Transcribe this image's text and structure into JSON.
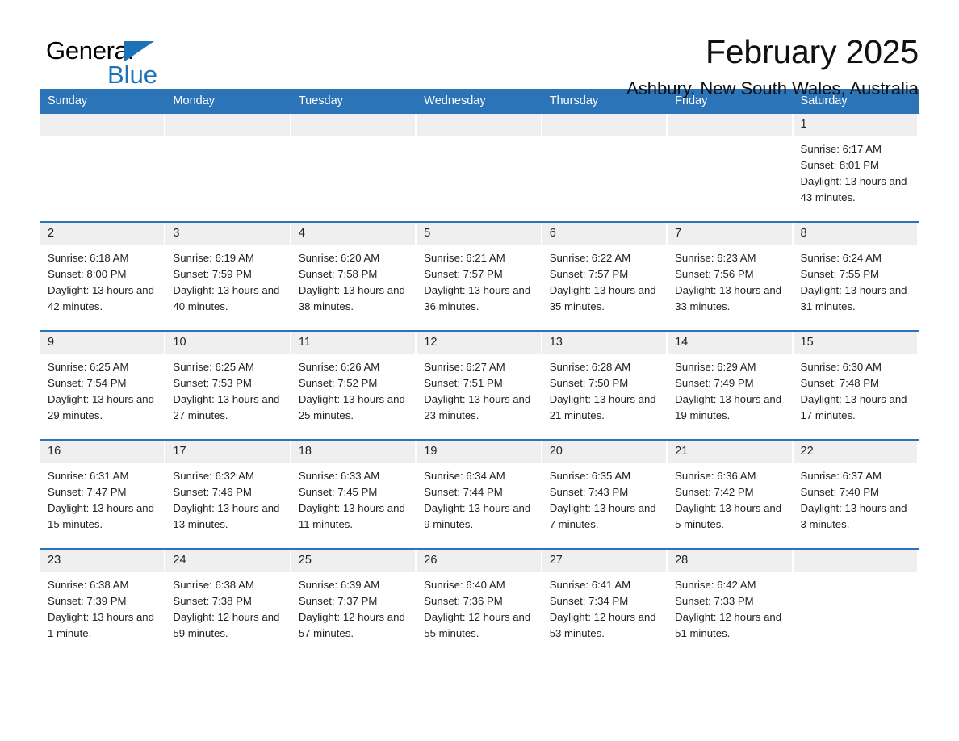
{
  "brand": {
    "name_part1": "General",
    "name_part2": "Blue",
    "triangle_color": "#1B74BA"
  },
  "header": {
    "title": "February 2025",
    "subtitle": "Ashbury, New South Wales, Australia"
  },
  "theme": {
    "header_blue": "#2B74B8",
    "daystrip_gray": "#efefef",
    "text": "#222222"
  },
  "weekday_headers": [
    "Sunday",
    "Monday",
    "Tuesday",
    "Wednesday",
    "Thursday",
    "Friday",
    "Saturday"
  ],
  "weeks": [
    [
      {
        "day": "",
        "empty": true
      },
      {
        "day": "",
        "empty": true
      },
      {
        "day": "",
        "empty": true
      },
      {
        "day": "",
        "empty": true
      },
      {
        "day": "",
        "empty": true
      },
      {
        "day": "",
        "empty": true
      },
      {
        "day": "1",
        "sunrise": "Sunrise: 6:17 AM",
        "sunset": "Sunset: 8:01 PM",
        "daylight": "Daylight: 13 hours and 43 minutes."
      }
    ],
    [
      {
        "day": "2",
        "sunrise": "Sunrise: 6:18 AM",
        "sunset": "Sunset: 8:00 PM",
        "daylight": "Daylight: 13 hours and 42 minutes."
      },
      {
        "day": "3",
        "sunrise": "Sunrise: 6:19 AM",
        "sunset": "Sunset: 7:59 PM",
        "daylight": "Daylight: 13 hours and 40 minutes."
      },
      {
        "day": "4",
        "sunrise": "Sunrise: 6:20 AM",
        "sunset": "Sunset: 7:58 PM",
        "daylight": "Daylight: 13 hours and 38 minutes."
      },
      {
        "day": "5",
        "sunrise": "Sunrise: 6:21 AM",
        "sunset": "Sunset: 7:57 PM",
        "daylight": "Daylight: 13 hours and 36 minutes."
      },
      {
        "day": "6",
        "sunrise": "Sunrise: 6:22 AM",
        "sunset": "Sunset: 7:57 PM",
        "daylight": "Daylight: 13 hours and 35 minutes."
      },
      {
        "day": "7",
        "sunrise": "Sunrise: 6:23 AM",
        "sunset": "Sunset: 7:56 PM",
        "daylight": "Daylight: 13 hours and 33 minutes."
      },
      {
        "day": "8",
        "sunrise": "Sunrise: 6:24 AM",
        "sunset": "Sunset: 7:55 PM",
        "daylight": "Daylight: 13 hours and 31 minutes."
      }
    ],
    [
      {
        "day": "9",
        "sunrise": "Sunrise: 6:25 AM",
        "sunset": "Sunset: 7:54 PM",
        "daylight": "Daylight: 13 hours and 29 minutes."
      },
      {
        "day": "10",
        "sunrise": "Sunrise: 6:25 AM",
        "sunset": "Sunset: 7:53 PM",
        "daylight": "Daylight: 13 hours and 27 minutes."
      },
      {
        "day": "11",
        "sunrise": "Sunrise: 6:26 AM",
        "sunset": "Sunset: 7:52 PM",
        "daylight": "Daylight: 13 hours and 25 minutes."
      },
      {
        "day": "12",
        "sunrise": "Sunrise: 6:27 AM",
        "sunset": "Sunset: 7:51 PM",
        "daylight": "Daylight: 13 hours and 23 minutes."
      },
      {
        "day": "13",
        "sunrise": "Sunrise: 6:28 AM",
        "sunset": "Sunset: 7:50 PM",
        "daylight": "Daylight: 13 hours and 21 minutes."
      },
      {
        "day": "14",
        "sunrise": "Sunrise: 6:29 AM",
        "sunset": "Sunset: 7:49 PM",
        "daylight": "Daylight: 13 hours and 19 minutes."
      },
      {
        "day": "15",
        "sunrise": "Sunrise: 6:30 AM",
        "sunset": "Sunset: 7:48 PM",
        "daylight": "Daylight: 13 hours and 17 minutes."
      }
    ],
    [
      {
        "day": "16",
        "sunrise": "Sunrise: 6:31 AM",
        "sunset": "Sunset: 7:47 PM",
        "daylight": "Daylight: 13 hours and 15 minutes."
      },
      {
        "day": "17",
        "sunrise": "Sunrise: 6:32 AM",
        "sunset": "Sunset: 7:46 PM",
        "daylight": "Daylight: 13 hours and 13 minutes."
      },
      {
        "day": "18",
        "sunrise": "Sunrise: 6:33 AM",
        "sunset": "Sunset: 7:45 PM",
        "daylight": "Daylight: 13 hours and 11 minutes."
      },
      {
        "day": "19",
        "sunrise": "Sunrise: 6:34 AM",
        "sunset": "Sunset: 7:44 PM",
        "daylight": "Daylight: 13 hours and 9 minutes."
      },
      {
        "day": "20",
        "sunrise": "Sunrise: 6:35 AM",
        "sunset": "Sunset: 7:43 PM",
        "daylight": "Daylight: 13 hours and 7 minutes."
      },
      {
        "day": "21",
        "sunrise": "Sunrise: 6:36 AM",
        "sunset": "Sunset: 7:42 PM",
        "daylight": "Daylight: 13 hours and 5 minutes."
      },
      {
        "day": "22",
        "sunrise": "Sunrise: 6:37 AM",
        "sunset": "Sunset: 7:40 PM",
        "daylight": "Daylight: 13 hours and 3 minutes."
      }
    ],
    [
      {
        "day": "23",
        "sunrise": "Sunrise: 6:38 AM",
        "sunset": "Sunset: 7:39 PM",
        "daylight": "Daylight: 13 hours and 1 minute."
      },
      {
        "day": "24",
        "sunrise": "Sunrise: 6:38 AM",
        "sunset": "Sunset: 7:38 PM",
        "daylight": "Daylight: 12 hours and 59 minutes."
      },
      {
        "day": "25",
        "sunrise": "Sunrise: 6:39 AM",
        "sunset": "Sunset: 7:37 PM",
        "daylight": "Daylight: 12 hours and 57 minutes."
      },
      {
        "day": "26",
        "sunrise": "Sunrise: 6:40 AM",
        "sunset": "Sunset: 7:36 PM",
        "daylight": "Daylight: 12 hours and 55 minutes."
      },
      {
        "day": "27",
        "sunrise": "Sunrise: 6:41 AM",
        "sunset": "Sunset: 7:34 PM",
        "daylight": "Daylight: 12 hours and 53 minutes."
      },
      {
        "day": "28",
        "sunrise": "Sunrise: 6:42 AM",
        "sunset": "Sunset: 7:33 PM",
        "daylight": "Daylight: 12 hours and 51 minutes."
      },
      {
        "day": "",
        "empty": true
      }
    ]
  ]
}
